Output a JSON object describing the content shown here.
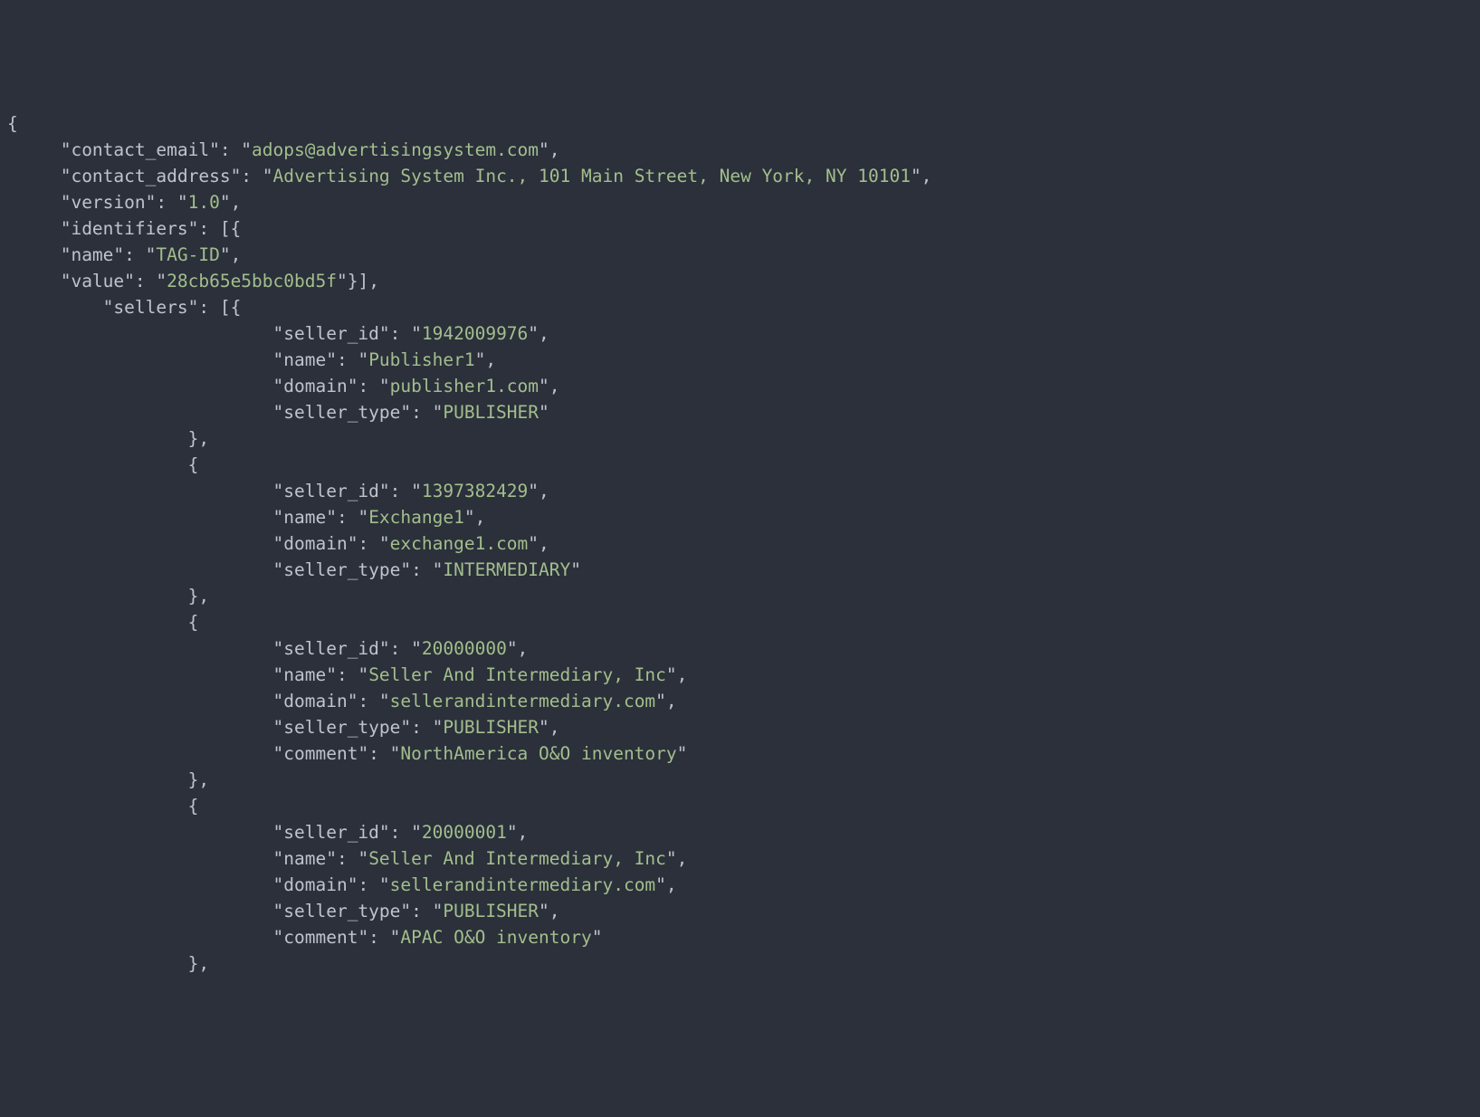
{
  "lines": [
    {
      "indent": 0,
      "segments": [
        {
          "t": "p",
          "v": "{"
        }
      ]
    },
    {
      "indent": 1,
      "segments": [
        {
          "t": "p",
          "v": "\""
        },
        {
          "t": "k",
          "v": "contact_email"
        },
        {
          "t": "p",
          "v": "\": \""
        },
        {
          "t": "s",
          "v": "adops@advertisingsystem.com"
        },
        {
          "t": "p",
          "v": "\","
        }
      ]
    },
    {
      "indent": 1,
      "segments": [
        {
          "t": "p",
          "v": "\""
        },
        {
          "t": "k",
          "v": "contact_address"
        },
        {
          "t": "p",
          "v": "\": \""
        },
        {
          "t": "s",
          "v": "Advertising System Inc., 101 Main Street, New York, NY 10101"
        },
        {
          "t": "p",
          "v": "\","
        }
      ]
    },
    {
      "indent": 1,
      "segments": [
        {
          "t": "p",
          "v": "\""
        },
        {
          "t": "k",
          "v": "version"
        },
        {
          "t": "p",
          "v": "\": \""
        },
        {
          "t": "s",
          "v": "1.0"
        },
        {
          "t": "p",
          "v": "\","
        }
      ]
    },
    {
      "indent": 1,
      "segments": [
        {
          "t": "p",
          "v": "\""
        },
        {
          "t": "k",
          "v": "identifiers"
        },
        {
          "t": "p",
          "v": "\": [{"
        }
      ]
    },
    {
      "indent": 1,
      "segments": [
        {
          "t": "p",
          "v": "\""
        },
        {
          "t": "k",
          "v": "name"
        },
        {
          "t": "p",
          "v": "\": \""
        },
        {
          "t": "s",
          "v": "TAG-ID"
        },
        {
          "t": "p",
          "v": "\","
        }
      ]
    },
    {
      "indent": 1,
      "segments": [
        {
          "t": "p",
          "v": "\""
        },
        {
          "t": "k",
          "v": "value"
        },
        {
          "t": "p",
          "v": "\": \""
        },
        {
          "t": "s",
          "v": "28cb65e5bbc0bd5f"
        },
        {
          "t": "p",
          "v": "\"}],"
        }
      ]
    },
    {
      "indent": 2,
      "segments": [
        {
          "t": "p",
          "v": "\""
        },
        {
          "t": "k",
          "v": "sellers"
        },
        {
          "t": "p",
          "v": "\": [{"
        }
      ]
    },
    {
      "indent": 6,
      "segments": [
        {
          "t": "p",
          "v": "\""
        },
        {
          "t": "k",
          "v": "seller_id"
        },
        {
          "t": "p",
          "v": "\": \""
        },
        {
          "t": "s",
          "v": "1942009976"
        },
        {
          "t": "p",
          "v": "\","
        }
      ]
    },
    {
      "indent": 6,
      "segments": [
        {
          "t": "p",
          "v": "\""
        },
        {
          "t": "k",
          "v": "name"
        },
        {
          "t": "p",
          "v": "\": \""
        },
        {
          "t": "s",
          "v": "Publisher1"
        },
        {
          "t": "p",
          "v": "\","
        }
      ]
    },
    {
      "indent": 6,
      "segments": [
        {
          "t": "p",
          "v": "\""
        },
        {
          "t": "k",
          "v": "domain"
        },
        {
          "t": "p",
          "v": "\": \""
        },
        {
          "t": "s",
          "v": "publisher1.com"
        },
        {
          "t": "p",
          "v": "\","
        }
      ]
    },
    {
      "indent": 6,
      "segments": [
        {
          "t": "p",
          "v": "\""
        },
        {
          "t": "k",
          "v": "seller_type"
        },
        {
          "t": "p",
          "v": "\": \""
        },
        {
          "t": "s",
          "v": "PUBLISHER"
        },
        {
          "t": "p",
          "v": "\""
        }
      ]
    },
    {
      "indent": 4,
      "segments": [
        {
          "t": "p",
          "v": "},"
        }
      ]
    },
    {
      "indent": 4,
      "segments": [
        {
          "t": "p",
          "v": "{"
        }
      ]
    },
    {
      "indent": 6,
      "segments": [
        {
          "t": "p",
          "v": "\""
        },
        {
          "t": "k",
          "v": "seller_id"
        },
        {
          "t": "p",
          "v": "\": \""
        },
        {
          "t": "s",
          "v": "1397382429"
        },
        {
          "t": "p",
          "v": "\","
        }
      ]
    },
    {
      "indent": 6,
      "segments": [
        {
          "t": "p",
          "v": "\""
        },
        {
          "t": "k",
          "v": "name"
        },
        {
          "t": "p",
          "v": "\": \""
        },
        {
          "t": "s",
          "v": "Exchange1"
        },
        {
          "t": "p",
          "v": "\","
        }
      ]
    },
    {
      "indent": 6,
      "segments": [
        {
          "t": "p",
          "v": "\""
        },
        {
          "t": "k",
          "v": "domain"
        },
        {
          "t": "p",
          "v": "\": \""
        },
        {
          "t": "s",
          "v": "exchange1.com"
        },
        {
          "t": "p",
          "v": "\","
        }
      ]
    },
    {
      "indent": 6,
      "segments": [
        {
          "t": "p",
          "v": "\""
        },
        {
          "t": "k",
          "v": "seller_type"
        },
        {
          "t": "p",
          "v": "\": \""
        },
        {
          "t": "s",
          "v": "INTERMEDIARY"
        },
        {
          "t": "p",
          "v": "\""
        }
      ]
    },
    {
      "indent": 4,
      "segments": [
        {
          "t": "p",
          "v": "},"
        }
      ]
    },
    {
      "indent": 4,
      "segments": [
        {
          "t": "p",
          "v": "{"
        }
      ]
    },
    {
      "indent": 6,
      "segments": [
        {
          "t": "p",
          "v": "\""
        },
        {
          "t": "k",
          "v": "seller_id"
        },
        {
          "t": "p",
          "v": "\": \""
        },
        {
          "t": "s",
          "v": "20000000"
        },
        {
          "t": "p",
          "v": "\","
        }
      ]
    },
    {
      "indent": 6,
      "segments": [
        {
          "t": "p",
          "v": "\""
        },
        {
          "t": "k",
          "v": "name"
        },
        {
          "t": "p",
          "v": "\": \""
        },
        {
          "t": "s",
          "v": "Seller And Intermediary, Inc"
        },
        {
          "t": "p",
          "v": "\","
        }
      ]
    },
    {
      "indent": 6,
      "segments": [
        {
          "t": "p",
          "v": "\""
        },
        {
          "t": "k",
          "v": "domain"
        },
        {
          "t": "p",
          "v": "\": \""
        },
        {
          "t": "s",
          "v": "sellerandintermediary.com"
        },
        {
          "t": "p",
          "v": "\","
        }
      ]
    },
    {
      "indent": 6,
      "segments": [
        {
          "t": "p",
          "v": "\""
        },
        {
          "t": "k",
          "v": "seller_type"
        },
        {
          "t": "p",
          "v": "\": \""
        },
        {
          "t": "s",
          "v": "PUBLISHER"
        },
        {
          "t": "p",
          "v": "\","
        }
      ]
    },
    {
      "indent": 6,
      "segments": [
        {
          "t": "p",
          "v": "\""
        },
        {
          "t": "k",
          "v": "comment"
        },
        {
          "t": "p",
          "v": "\": \""
        },
        {
          "t": "s",
          "v": "NorthAmerica O&O inventory"
        },
        {
          "t": "p",
          "v": "\""
        }
      ]
    },
    {
      "indent": 4,
      "segments": [
        {
          "t": "p",
          "v": "},"
        }
      ]
    },
    {
      "indent": 4,
      "segments": [
        {
          "t": "p",
          "v": "{"
        }
      ]
    },
    {
      "indent": 6,
      "segments": [
        {
          "t": "p",
          "v": "\""
        },
        {
          "t": "k",
          "v": "seller_id"
        },
        {
          "t": "p",
          "v": "\": \""
        },
        {
          "t": "s",
          "v": "20000001"
        },
        {
          "t": "p",
          "v": "\","
        }
      ]
    },
    {
      "indent": 6,
      "segments": [
        {
          "t": "p",
          "v": "\""
        },
        {
          "t": "k",
          "v": "name"
        },
        {
          "t": "p",
          "v": "\": \""
        },
        {
          "t": "s",
          "v": "Seller And Intermediary, Inc"
        },
        {
          "t": "p",
          "v": "\","
        }
      ]
    },
    {
      "indent": 6,
      "segments": [
        {
          "t": "p",
          "v": "\""
        },
        {
          "t": "k",
          "v": "domain"
        },
        {
          "t": "p",
          "v": "\": \""
        },
        {
          "t": "s",
          "v": "sellerandintermediary.com"
        },
        {
          "t": "p",
          "v": "\","
        }
      ]
    },
    {
      "indent": 6,
      "segments": [
        {
          "t": "p",
          "v": "\""
        },
        {
          "t": "k",
          "v": "seller_type"
        },
        {
          "t": "p",
          "v": "\": \""
        },
        {
          "t": "s",
          "v": "PUBLISHER"
        },
        {
          "t": "p",
          "v": "\","
        }
      ]
    },
    {
      "indent": 6,
      "segments": [
        {
          "t": "p",
          "v": "\""
        },
        {
          "t": "k",
          "v": "comment"
        },
        {
          "t": "p",
          "v": "\": \""
        },
        {
          "t": "s",
          "v": "APAC O&O inventory"
        },
        {
          "t": "p",
          "v": "\""
        }
      ]
    },
    {
      "indent": 4,
      "segments": [
        {
          "t": "p",
          "v": "},"
        }
      ]
    }
  ]
}
